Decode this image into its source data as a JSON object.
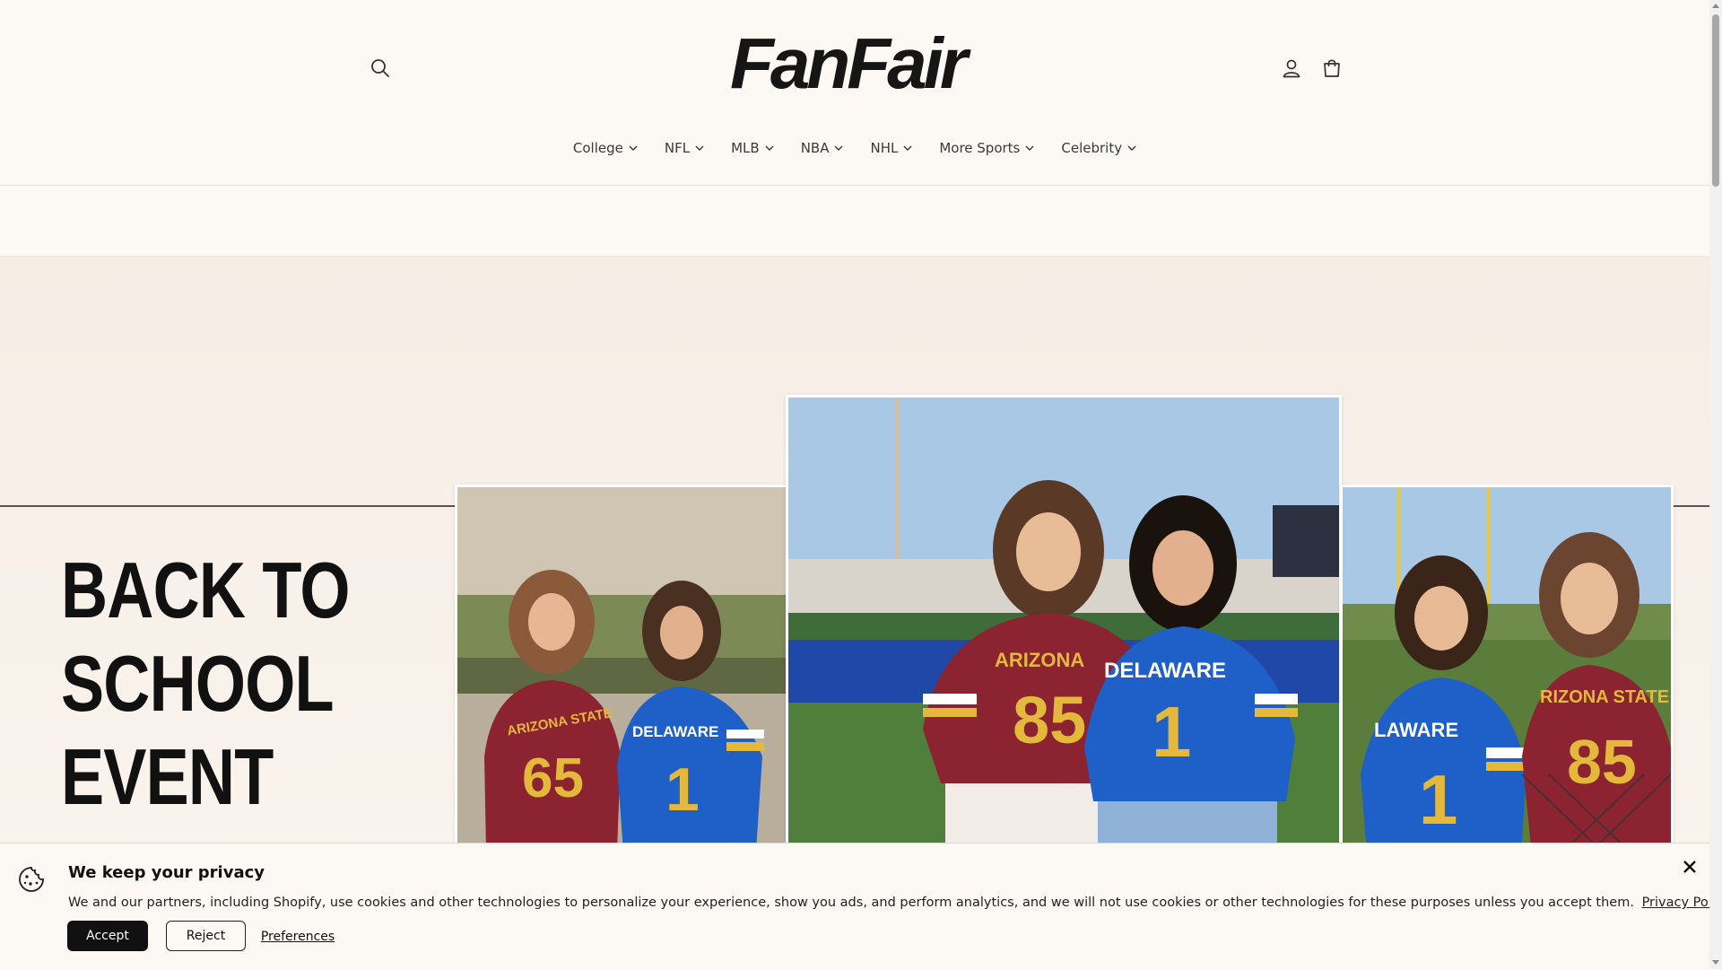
{
  "brand": {
    "logo_text": "FanFair"
  },
  "header": {
    "search_icon": "search-icon",
    "account_icon": "user-icon",
    "cart_icon": "cart-icon"
  },
  "nav": {
    "items": [
      {
        "label": "College"
      },
      {
        "label": "NFL"
      },
      {
        "label": "MLB"
      },
      {
        "label": "NBA"
      },
      {
        "label": "NHL"
      },
      {
        "label": "More Sports"
      },
      {
        "label": "Celebrity"
      }
    ]
  },
  "hero": {
    "title_lines": [
      "BACK TO",
      "SCHOOL",
      "EVENT"
    ],
    "photo_left": {
      "jersey_a_text": "ARIZONA STATE",
      "jersey_a_number": "65",
      "jersey_b_text": "DELAWARE",
      "jersey_b_number": "1"
    },
    "photo_center": {
      "jersey_a_text": "ARIZONA",
      "jersey_a_number": "85",
      "jersey_b_text": "DELAWARE",
      "jersey_b_number": "1"
    },
    "photo_right": {
      "jersey_a_text": "LAWARE",
      "jersey_a_number": "1",
      "jersey_b_text": "RIZONA STATE",
      "jersey_b_number": "85"
    }
  },
  "cookie": {
    "title": "We keep your privacy",
    "text": "We and our partners, including Shopify, use cookies and other technologies to personalize your experience, show you ads, and perform analytics, and we will not use cookies or other technologies for these purposes unless you accept them.",
    "privacy_link": "Privacy Policy",
    "accept_label": "Accept",
    "reject_label": "Reject",
    "preferences_label": "Preferences"
  },
  "colors": {
    "background": "#fcf9f4",
    "maroon": "#8b2331",
    "gold": "#e4b83b",
    "royal_blue": "#1f5fc8",
    "sky": "#a9c8e6"
  }
}
